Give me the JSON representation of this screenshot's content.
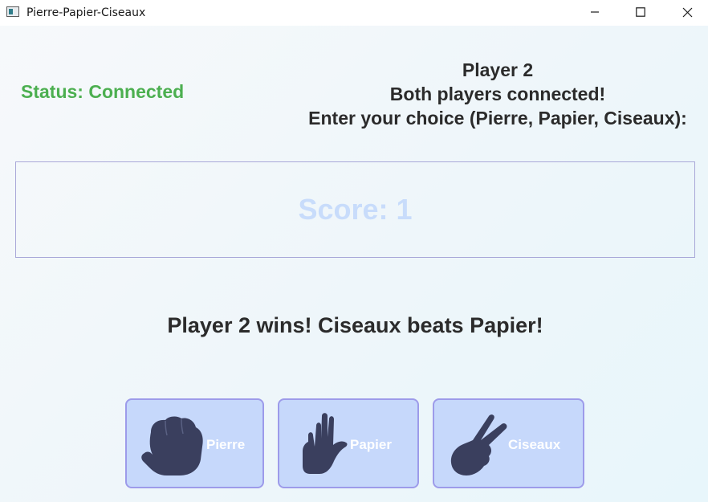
{
  "window": {
    "title": "Pierre-Papier-Ciseaux",
    "controls": [
      "minimize-icon",
      "maximize-icon",
      "close-icon"
    ]
  },
  "status": {
    "text": "Status: Connected",
    "color": "#4caf50"
  },
  "info": {
    "player": "Player 2",
    "message": "Both players connected!",
    "prompt": "Enter your choice (Pierre, Papier, Ciseaux):"
  },
  "score": {
    "text": "Score: 1"
  },
  "result": {
    "text": "Player 2 wins! Ciseaux beats Papier!"
  },
  "choices": [
    {
      "label": "Pierre",
      "icon": "fist-icon"
    },
    {
      "label": "Papier",
      "icon": "open-hand-icon"
    },
    {
      "label": "Ciseaux",
      "icon": "scissors-hand-icon"
    }
  ],
  "colors": {
    "button_bg": "#c6d8fb",
    "button_border": "#9d9bea",
    "hand": "#3a3f5e",
    "score_text": "#c8dcfb"
  }
}
